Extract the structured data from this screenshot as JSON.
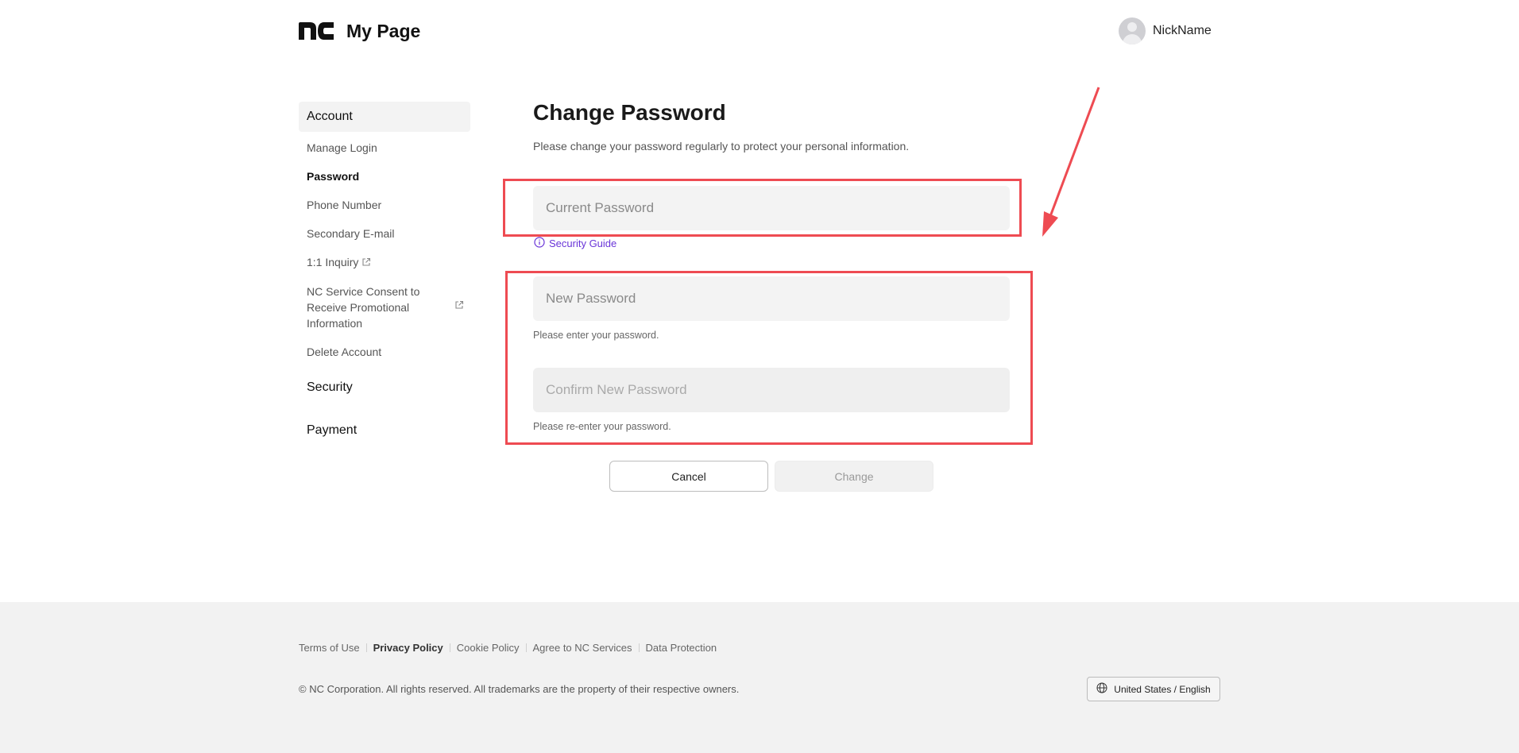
{
  "header": {
    "logo_text": "nc",
    "title": "My Page",
    "username": "NickName"
  },
  "sidebar": {
    "sections": [
      {
        "label": "Account",
        "items": [
          {
            "label": "Manage Login",
            "current": false,
            "external": false
          },
          {
            "label": "Password",
            "current": true,
            "external": false
          },
          {
            "label": "Phone Number",
            "current": false,
            "external": false
          },
          {
            "label": "Secondary E-mail",
            "current": false,
            "external": false
          },
          {
            "label": "1:1 Inquiry",
            "current": false,
            "external": true
          },
          {
            "label": "NC Service Consent to Receive Promotional Information",
            "current": false,
            "external": true
          },
          {
            "label": "Delete Account",
            "current": false,
            "external": false
          }
        ]
      },
      {
        "label": "Security"
      },
      {
        "label": "Payment"
      }
    ]
  },
  "main": {
    "heading": "Change Password",
    "description": "Please change your password regularly to protect your personal information.",
    "current_password_placeholder": "Current Password",
    "security_guide": "Security Guide",
    "new_password_placeholder": "New Password",
    "new_password_hint": "Please enter your password.",
    "confirm_password_placeholder": "Confirm New Password",
    "confirm_password_hint": "Please re-enter your password.",
    "cancel_label": "Cancel",
    "change_label": "Change"
  },
  "footer": {
    "links": [
      "Terms of Use",
      "Privacy Policy",
      "Cookie Policy",
      "Agree to NC Services",
      "Data Protection"
    ],
    "copyright": "© NC Corporation. All rights reserved. All trademarks are the property of their respective owners.",
    "language": "United States / English"
  },
  "colors": {
    "accent_link": "#6a35d8",
    "annotation": "#ee4b52",
    "footer_bg": "#f2f2f2"
  }
}
